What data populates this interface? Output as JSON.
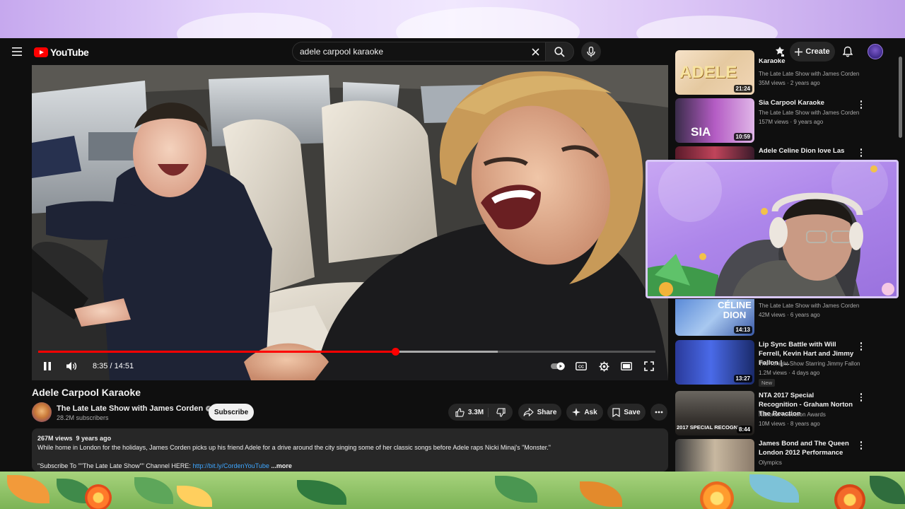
{
  "masthead": {
    "logo_text": "YouTube",
    "search": {
      "value": "adele carpool karaoke",
      "placeholder": "Search"
    },
    "create_label": "Create"
  },
  "player": {
    "current_time": "8:35",
    "duration": "14:51",
    "time_display": "8:35 / 14:51",
    "played_fraction": 0.578,
    "buffered_fraction": 0.745,
    "accent_color": "#ff0000"
  },
  "video": {
    "title": "Adele Carpool Karaoke",
    "channel": "The Late Late Show with James Corden",
    "subscribers": "28.2M subscribers",
    "subscribe_label": "Subscribe",
    "likes": "3.3M",
    "share_label": "Share",
    "ask_label": "Ask",
    "save_label": "Save"
  },
  "description": {
    "stats": "267M views  9 years ago",
    "line1": "While home in London for the holidays, James Corden picks up his friend Adele for a drive around the city singing some of her classic songs before Adele raps Nicki Minaj's \"Monster.\"",
    "line2_prefix": "\"Subscribe To \"\"The Late Late Show\"\" Channel HERE: ",
    "link": "http://bit.ly/CordenYouTube",
    "more_label": "...more"
  },
  "sidebar": {
    "items": [
      {
        "title": "Karaoke",
        "channel": "The Late Late Show with James Corden",
        "meta": "35M views · 2 years ago",
        "duration": "21:24"
      },
      {
        "title": "Sia Carpool Karaoke",
        "channel": "The Late Late Show with James Corden",
        "meta": "157M views · 9 years ago",
        "duration": "10:59"
      },
      {
        "title": "Adele Celine Dion love Las",
        "channel": "",
        "meta": "",
        "duration": ""
      },
      {
        "title": "",
        "channel": "The Late Late Show with James Corden",
        "meta": "42M views · 6 years ago",
        "duration": "14:13"
      },
      {
        "title": "Lip Sync Battle with Will Ferrell, Kevin Hart and Jimmy Fallon | ...",
        "channel": "The Tonight Show Starring Jimmy Fallon",
        "meta": "1.2M views · 4 days ago",
        "duration": "13:27",
        "badge": "New"
      },
      {
        "title": "NTA 2017  Special Recognition - Graham Norton The Reaction",
        "channel": "National Television Awards",
        "meta": "10M views · 8 years ago",
        "duration": "8:44"
      },
      {
        "title": "James Bond and The Queen London 2012 Performance",
        "channel": "Olympics",
        "meta": "",
        "duration": ""
      }
    ],
    "thumb_texts": {
      "adele": "ADELE",
      "sia": "SIA",
      "celine": "CÉLINE DION",
      "nta": "2017 SPECIAL RECOGNITION"
    }
  },
  "icons": [
    "menu-icon",
    "youtube-logo-icon",
    "clear-icon",
    "search-icon",
    "mic-icon",
    "cast-icon",
    "plus-icon",
    "bell-icon",
    "pause-icon",
    "volume-icon",
    "autoplay-icon",
    "cc-icon",
    "settings-icon",
    "theater-icon",
    "fullscreen-icon",
    "like-icon",
    "dislike-icon",
    "share-icon",
    "ask-icon",
    "save-icon",
    "more-icon",
    "verified-icon"
  ]
}
